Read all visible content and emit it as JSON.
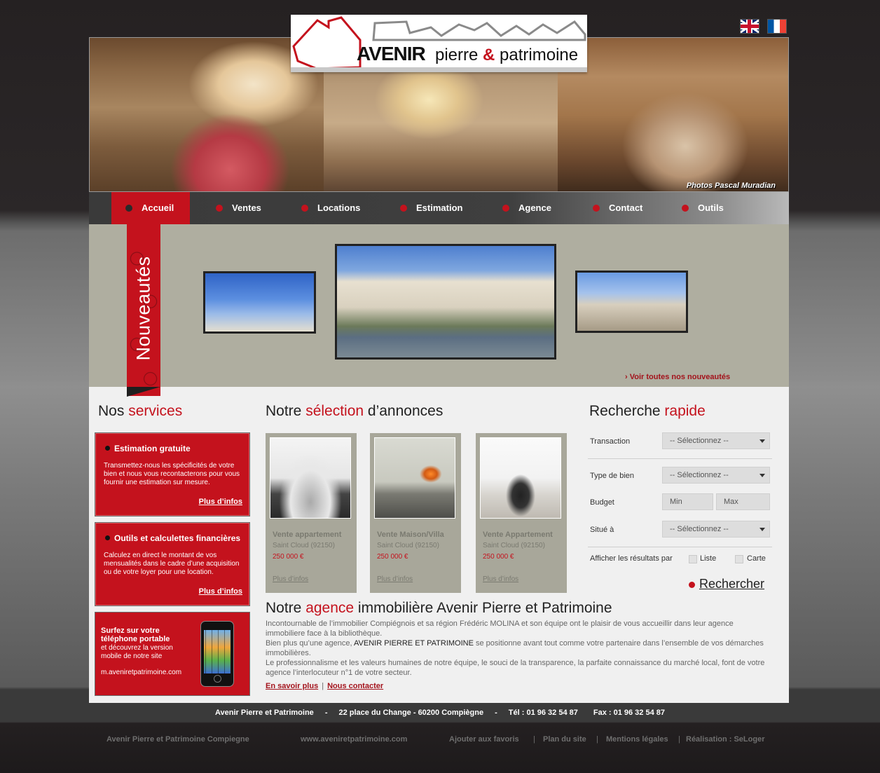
{
  "flags": {
    "en": "English",
    "fr": "Français"
  },
  "logo": {
    "word1": "AVENIR",
    "word2": "pierre",
    "amp": "&",
    "word3": "patrimoine"
  },
  "hero": {
    "credit": "Photos Pascal Muradian"
  },
  "nav": [
    {
      "label": "Accueil",
      "active": true
    },
    {
      "label": "Ventes"
    },
    {
      "label": "Locations"
    },
    {
      "label": "Estimation"
    },
    {
      "label": "Agence"
    },
    {
      "label": "Contact"
    },
    {
      "label": "Outils"
    }
  ],
  "news": {
    "ribbon": "Nouveautés",
    "see_all": "› Voir toutes nos nouveautés"
  },
  "services": {
    "title_a": "Nos ",
    "title_b": "services",
    "items": [
      {
        "title": "Estimation gratuite",
        "text": "Transmettez-nous les spécificités de votre bien et nous vous recontacterons pour vous fournir une estimation sur mesure.",
        "more": "Plus d’infos"
      },
      {
        "title": "Outils et calculettes financières",
        "text": "Calculez en direct le montant de vos mensualités dans le cadre d’une acquisition ou de votre loyer pour une location.",
        "more": "Plus d’infos"
      }
    ],
    "mobile": {
      "title": "Surfez sur votre téléphone portable",
      "text": "et découvrez la version mobile de notre site",
      "url": "m.aveniretpatrimoine.com"
    }
  },
  "selection": {
    "title_a": "Notre ",
    "title_b": "sélection",
    "title_c": " d’annonces",
    "cards": [
      {
        "type": "Vente appartement",
        "location": "Saint Cloud  (92150)",
        "price": "250 000 €",
        "more": "Plus d’infos"
      },
      {
        "type": "Vente Maison/Villa",
        "location": "Saint Cloud  (92150)",
        "price": "250 000 €",
        "more": "Plus d’infos"
      },
      {
        "type": "Vente Appartement",
        "location": "Saint Cloud  (92150)",
        "price": "250 000 €",
        "more": "Plus d’infos"
      }
    ]
  },
  "search": {
    "title_a": "Recherche ",
    "title_b": "rapide",
    "transaction_label": "Transaction",
    "transaction_value": "-- Sélectionnez --",
    "type_label": "Type de bien",
    "type_value": "-- Sélectionnez --",
    "budget_label": "Budget",
    "budget_min": "Min",
    "budget_max": "Max",
    "situe_label": "Situé à",
    "situe_value": "-- Sélectionnez --",
    "display_label": "Afficher les résultats par",
    "opt_list": "Liste",
    "opt_map": "Carte",
    "button": "Rechercher"
  },
  "agency": {
    "title_a": "Notre ",
    "title_b": "agence",
    "title_c": " immobilière Avenir Pierre et Patrimoine",
    "p1": "Incontournable de l’immobilier Compiégnois et sa région Frédéric MOLINA et son équipe ont le plaisir de vous accueillir dans leur agence immobiliere face à la bibliothèque.",
    "p2a": "Bien plus qu’une agence, ",
    "p2b": "AVENIR PIERRE ET PATRIMOINE",
    "p2c": " se positionne avant tout comme votre partenaire dans l’ensemble de vos démarches immobilières.",
    "p3": "Le professionnalisme et les valeurs humaines de notre équipe, le souci de la transparence, la parfaite connaissance du marché local, font de votre agence l’interlocuteur n°1 de votre secteur.",
    "link1": "En savoir plus",
    "sep": "|",
    "link2": "Nous contacter"
  },
  "footer": {
    "company": "Avenir Pierre et Patrimoine",
    "address": "22 place du Change - 60200 Compiègne",
    "tel": "Tél : 01 96 32 54 87",
    "fax": "Fax : 01 96 32 54 87",
    "dash": "-",
    "links": {
      "brand": "Avenir Pierre et Patrimoine Compiegne",
      "site": "www.aveniretpatrimoine.com",
      "favorites": "Ajouter aux favoris",
      "sitemap": "Plan du site",
      "legal": "Mentions légales",
      "credit": "Réalisation : SeLoger",
      "sep": "|"
    }
  }
}
